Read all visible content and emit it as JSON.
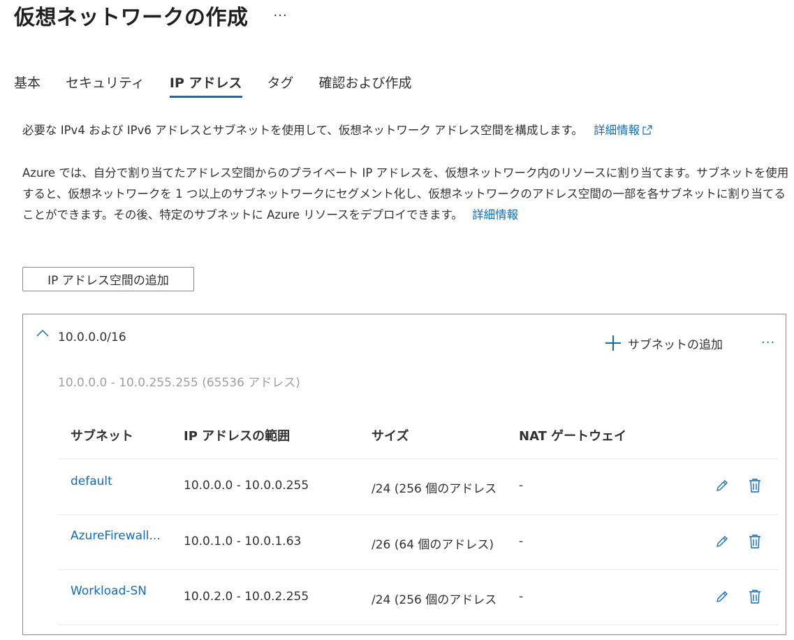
{
  "header": {
    "title": "仮想ネットワークの作成",
    "more": "···"
  },
  "tabs": [
    {
      "label": "基本"
    },
    {
      "label": "セキュリティ"
    },
    {
      "label": "IP アドレス",
      "active": true
    },
    {
      "label": "タグ"
    },
    {
      "label": "確認および作成"
    }
  ],
  "intro": {
    "text": "必要な IPv4 および IPv6 アドレスとサブネットを使用して、仮想ネットワーク アドレス空間を構成します。",
    "link": "詳細情報"
  },
  "description": {
    "text": "Azure では、自分で割り当てたアドレス空間からのプライベート IP アドレスを、仮想ネットワーク内のリソースに割り当てます。サブネットを使用すると、仮想ネットワークを 1 つ以上のサブネットワークにセグメント化し、仮想ネットワークのアドレス空間の一部を各サブネットに割り当てることができます。その後、特定のサブネットに Azure リソースをデプロイできます。",
    "link": "詳細情報"
  },
  "add_address_space_label": "IP アドレス空間の追加",
  "address_space": {
    "cidr": "10.0.0.0/16",
    "range": "10.0.0.0 - 10.0.255.255 (65536 アドレス)",
    "add_subnet_label": "サブネットの追加",
    "more": "···",
    "columns": [
      "サブネット",
      "IP アドレスの範囲",
      "サイズ",
      "NAT ゲートウェイ"
    ],
    "subnets": [
      {
        "name": "default",
        "range": "10.0.0.0 - 10.0.0.255",
        "size": "/24 (256 個のアドレス",
        "nat": "-"
      },
      {
        "name": "AzureFirewall...",
        "range": "10.0.1.0 - 10.0.1.63",
        "size": "/26 (64 個のアドレス)",
        "nat": "-"
      },
      {
        "name": "Workload-SN",
        "range": "10.0.2.0 - 10.0.2.255",
        "size": "/24 (256 個のアドレス",
        "nat": "-"
      }
    ]
  },
  "colors": {
    "accent": "#0f6cbd",
    "text": "#323130",
    "muted": "#a19f9d",
    "border": "#8a8886"
  }
}
